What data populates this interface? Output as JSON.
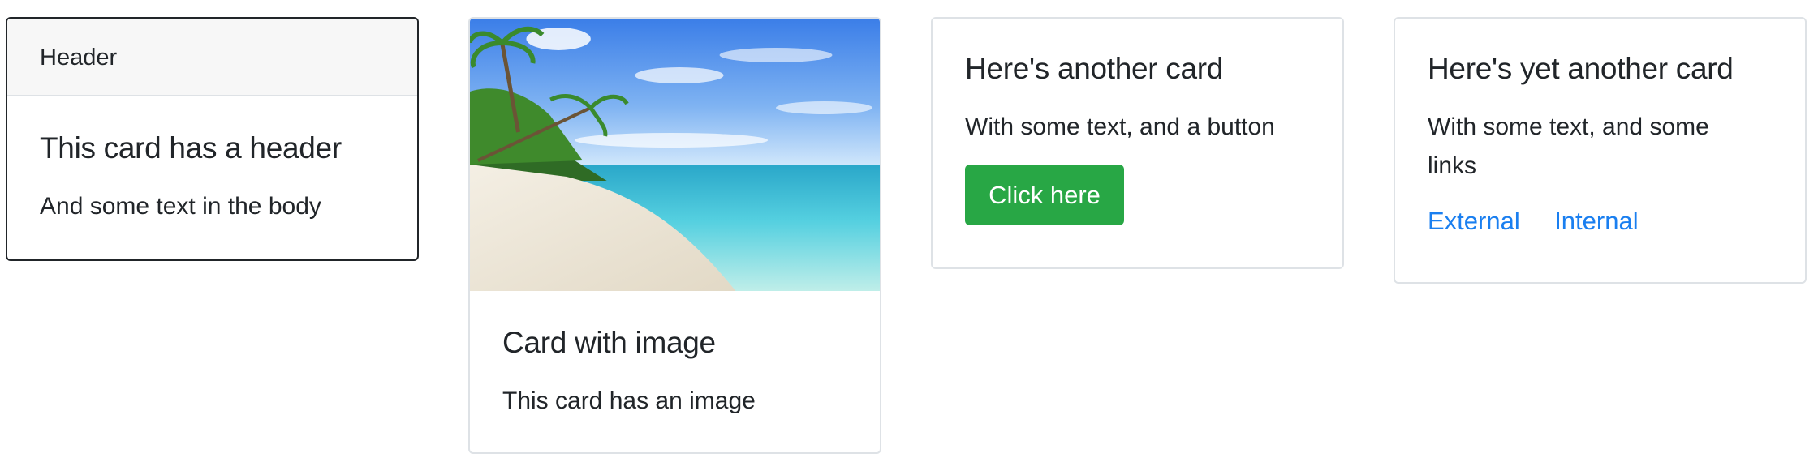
{
  "cards": [
    {
      "header": "Header",
      "title": "This card has a header",
      "text": "And some text in the body"
    },
    {
      "image": "beach-photo",
      "title": "Card with image",
      "text": "This card has an image"
    },
    {
      "title": "Here's another card",
      "text": "With some text, and a button",
      "button_label": "Click here"
    },
    {
      "title": "Here's yet another card",
      "text": "With some text, and some links",
      "links": [
        "External",
        "Internal"
      ]
    }
  ],
  "colors": {
    "button_bg": "#28a745",
    "link": "#1a7ff0",
    "text": "#212529",
    "border": "#dee2e6",
    "header_bg": "#f7f7f7"
  }
}
